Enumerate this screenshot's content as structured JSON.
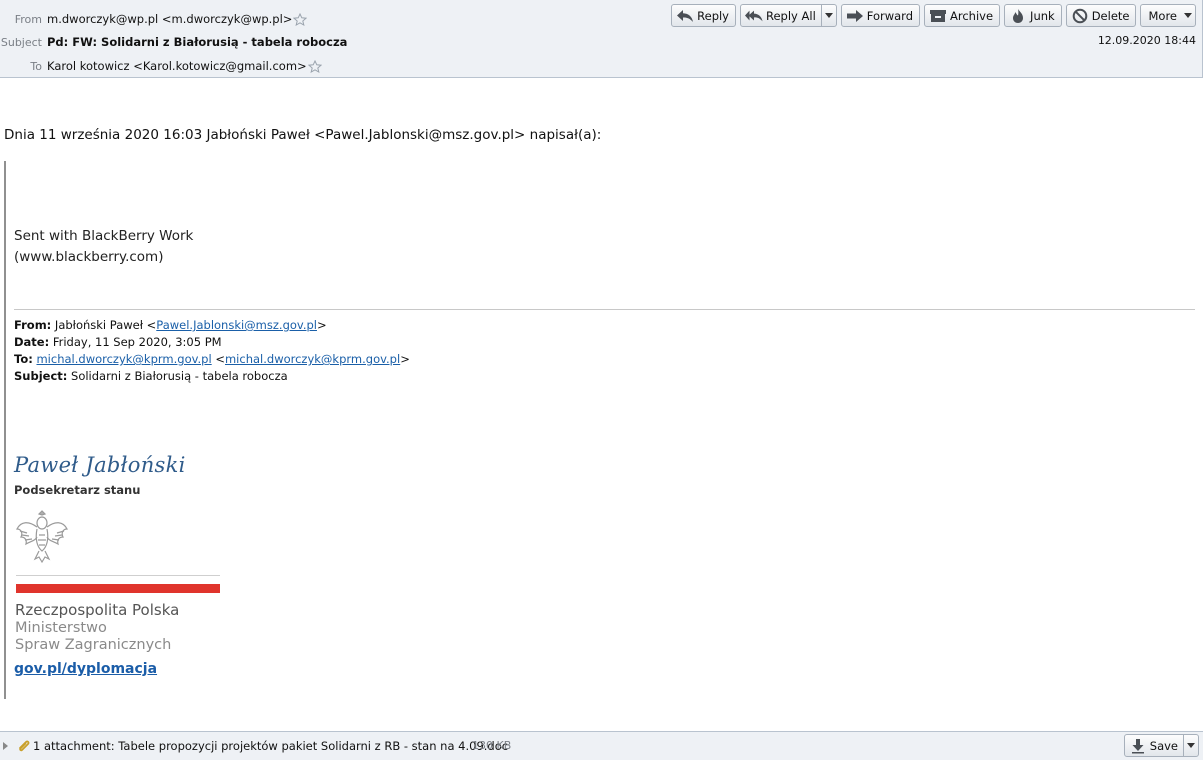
{
  "header": {
    "from_label": "From",
    "from_value": "m.dworczyk@wp.pl <m.dworczyk@wp.pl>",
    "subject_label": "Subject",
    "subject_value": "Pd: FW: Solidarni z Białorusią - tabela robocza",
    "to_label": "To",
    "to_value": "Karol kotowicz <Karol.kotowicz@gmail.com>",
    "date": "12.09.2020 18:44"
  },
  "toolbar": {
    "reply": "Reply",
    "reply_all": "Reply All",
    "forward": "Forward",
    "archive": "Archive",
    "junk": "Junk",
    "delete": "Delete",
    "more": "More"
  },
  "message": {
    "intro": "Dnia 11 września 2020 16:03 Jabłoński Paweł <Pawel.Jablonski@msz.gov.pl> napisał(a):",
    "bb_line1": "Sent with BlackBerry Work",
    "bb_line2": "(www.blackberry.com)",
    "forwarded": {
      "from_label": "From:",
      "from_name": " Jabłoński Paweł <",
      "from_email": "Pawel.Jablonski@msz.gov.pl",
      "from_close": ">",
      "date_label": "Date:",
      "date_value": " Friday, 11 Sep 2020, 3:05 PM",
      "to_label": "To:",
      "to_email1": "michal.dworczyk@kprm.gov.pl",
      "to_mid": " <",
      "to_email2": "michal.dworczyk@kprm.gov.pl",
      "to_close": ">",
      "subject_label": "Subject:",
      "subject_value": " Solidarni z Białorusią - tabela robocza"
    },
    "signature": {
      "name": "Paweł Jabłoński",
      "title": "Podsekretarz stanu",
      "org1": "Rzeczpospolita Polska",
      "org2": "Ministerstwo",
      "org3": "Spraw Zagranicznych",
      "link": "gov.pl/dyplomacja"
    }
  },
  "attachment": {
    "label": "1 attachment: Tabele propozycji projektów pakiet Solidarni z RB - stan na 4.09.doc",
    "size": "130 KB",
    "save": "Save"
  },
  "colors": {
    "header_bg": "#eef1f5",
    "link": "#1a5fa8",
    "flag_red": "#e0342c",
    "signature_name": "#2f5b8a"
  }
}
